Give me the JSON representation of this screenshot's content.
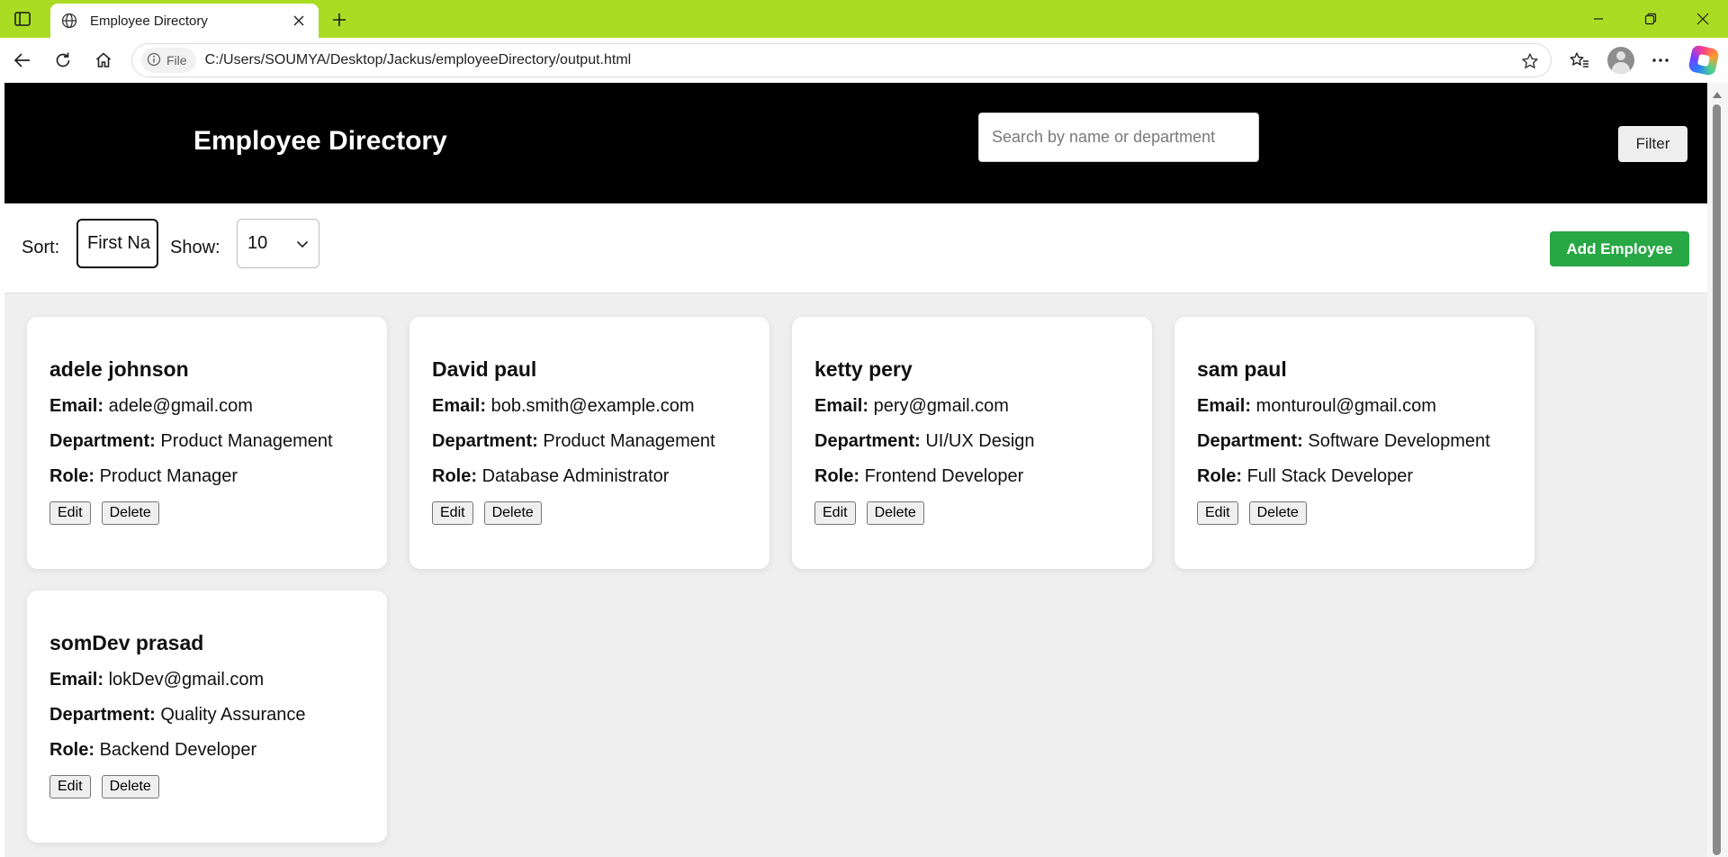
{
  "browser": {
    "tab_title": "Employee Directory",
    "address_chip": "File",
    "url": "C:/Users/SOUMYA/Desktop/Jackus/employeeDirectory/output.html"
  },
  "app": {
    "title": "Employee Directory",
    "search_placeholder": "Search by name or department",
    "filter_label": "Filter",
    "sort_label": "Sort:",
    "sort_value": "First Na",
    "show_label": "Show:",
    "show_value": "10",
    "add_label": "Add Employee",
    "colors": {
      "header_bg": "#000000",
      "accent": "#28a745",
      "titlebar": "#a9dc23"
    }
  },
  "employees": [
    {
      "name": "adele johnson",
      "email_label": "Email:",
      "email": "adele@gmail.com",
      "dept_label": "Department:",
      "department": "Product Management",
      "role_label": "Role:",
      "role": "Product Manager",
      "edit": "Edit",
      "delete": "Delete"
    },
    {
      "name": "David paul",
      "email_label": "Email:",
      "email": "bob.smith@example.com",
      "dept_label": "Department:",
      "department": "Product Management",
      "role_label": "Role:",
      "role": "Database Administrator",
      "edit": "Edit",
      "delete": "Delete"
    },
    {
      "name": "ketty pery",
      "email_label": "Email:",
      "email": "pery@gmail.com",
      "dept_label": "Department:",
      "department": "UI/UX Design",
      "role_label": "Role:",
      "role": "Frontend Developer",
      "edit": "Edit",
      "delete": "Delete"
    },
    {
      "name": "sam paul",
      "email_label": "Email:",
      "email": "monturoul@gmail.com",
      "dept_label": "Department:",
      "department": "Software Development",
      "role_label": "Role:",
      "role": "Full Stack Developer",
      "edit": "Edit",
      "delete": "Delete"
    },
    {
      "name": "somDev prasad",
      "email_label": "Email:",
      "email": "lokDev@gmail.com",
      "dept_label": "Department:",
      "department": "Quality Assurance",
      "role_label": "Role:",
      "role": "Backend Developer",
      "edit": "Edit",
      "delete": "Delete"
    }
  ]
}
